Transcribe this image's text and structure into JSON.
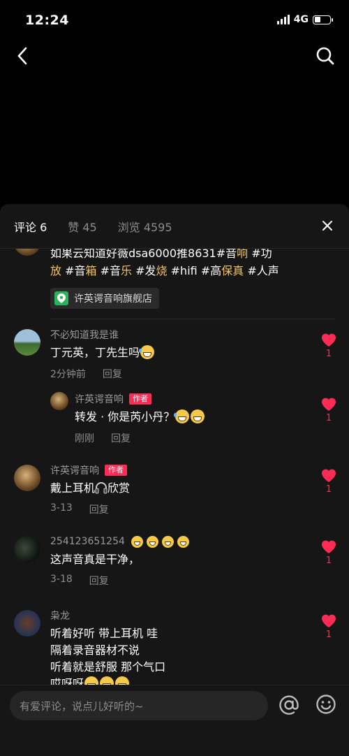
{
  "status": {
    "time": "12:24",
    "network": "4G"
  },
  "header": {
    "back_icon": "back-arrow-icon",
    "search_icon": "search-icon"
  },
  "tabs": [
    {
      "label": "评论 6"
    },
    {
      "label": "赞 45"
    },
    {
      "label": "浏览 4595"
    }
  ],
  "post": {
    "text_parts": [
      "如果云知道好薇dsa6000推8631#音",
      "响",
      " #功",
      "放",
      " #音",
      "箱",
      " #音",
      "乐",
      " #发",
      "烧",
      " #hifi #高",
      "保真",
      " #人声"
    ],
    "shop_label": "许英谔音响旗舰店"
  },
  "comments": [
    {
      "user": "不必知道我是谁",
      "text": "丁元英，丁先生吗",
      "time": "2分钟前",
      "reply_label": "回复",
      "likes": "1"
    },
    {
      "user": "许英谔音响",
      "badge": "作者",
      "text": "转发 · 你是芮小丹？",
      "time": "刚刚",
      "reply_label": "回复",
      "likes": "1"
    },
    {
      "user": "许英谔音响",
      "badge": "作者",
      "text_before": "戴上耳机",
      "text_after": "欣赏",
      "time": "3-13",
      "reply_label": "回复",
      "likes": "1"
    },
    {
      "user": "254123651254",
      "text": "这声音真是干净，",
      "time": "3-18",
      "reply_label": "回复",
      "likes": "1"
    },
    {
      "user": "枭龙",
      "lines": [
        "听着好听 带上耳机 哇",
        "隔着录音器材不说",
        "听着就是舒服 那个气口",
        "哎呀呀"
      ],
      "likes": "1"
    }
  ],
  "input": {
    "placeholder": "有爱评论，说点儿好听的~"
  },
  "colors": {
    "accent": "#fe2c55",
    "tag": "#f5c25c",
    "sheet_bg": "#161616"
  }
}
